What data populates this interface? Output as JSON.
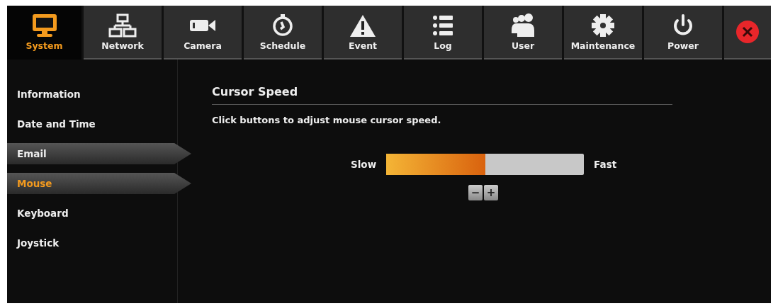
{
  "tabs": [
    {
      "label": "System",
      "selected": true
    },
    {
      "label": "Network",
      "selected": false
    },
    {
      "label": "Camera",
      "selected": false
    },
    {
      "label": "Schedule",
      "selected": false
    },
    {
      "label": "Event",
      "selected": false
    },
    {
      "label": "Log",
      "selected": false
    },
    {
      "label": "User",
      "selected": false
    },
    {
      "label": "Maintenance",
      "selected": false
    },
    {
      "label": "Power",
      "selected": false
    }
  ],
  "sidebar": {
    "items": [
      {
        "label": "Information",
        "selected": false,
        "hovered": false
      },
      {
        "label": "Date and Time",
        "selected": false,
        "hovered": false
      },
      {
        "label": "Email",
        "selected": false,
        "hovered": true
      },
      {
        "label": "Mouse",
        "selected": true,
        "hovered": true
      },
      {
        "label": "Keyboard",
        "selected": false,
        "hovered": false
      },
      {
        "label": "Joystick",
        "selected": false,
        "hovered": false
      }
    ]
  },
  "section": {
    "title": "Cursor Speed",
    "description": "Click buttons to adjust mouse cursor speed.",
    "slider": {
      "min_label": "Slow",
      "max_label": "Fast",
      "level": 0.5
    },
    "buttons": [
      "−",
      "+"
    ]
  }
}
